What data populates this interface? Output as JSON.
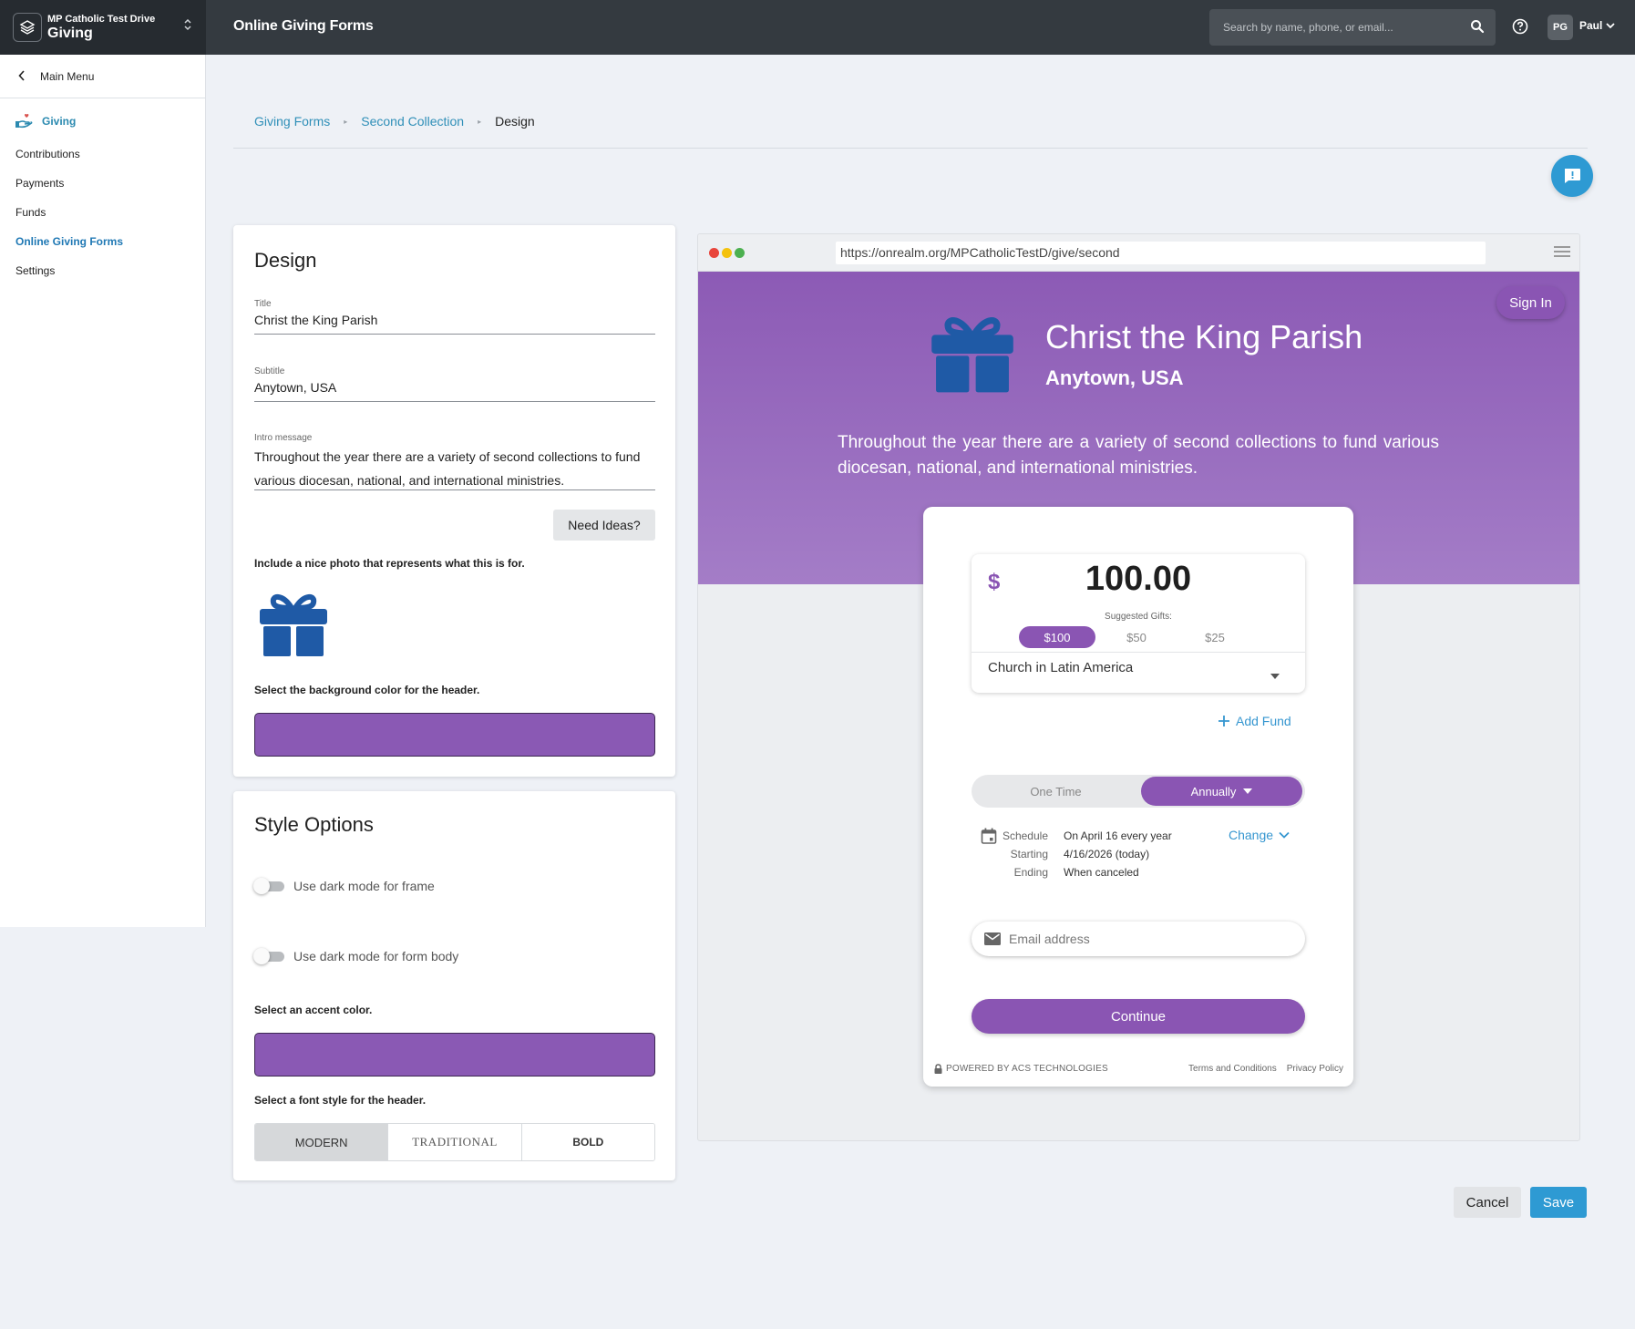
{
  "app": {
    "org": "MP Catholic Test Drive",
    "name": "Giving",
    "page_heading": "Online Giving Forms",
    "search_placeholder": "Search by name, phone, or email...",
    "user_initials": "PG",
    "user_name": "Paul"
  },
  "sidebar": {
    "main_menu": "Main Menu",
    "section": "Giving",
    "items": [
      {
        "label": "Contributions",
        "active": false
      },
      {
        "label": "Payments",
        "active": false
      },
      {
        "label": "Funds",
        "active": false
      },
      {
        "label": "Online Giving Forms",
        "active": true
      },
      {
        "label": "Settings",
        "active": false
      }
    ]
  },
  "breadcrumb": [
    "Giving Forms",
    "Second Collection",
    "Design"
  ],
  "design": {
    "heading": "Design",
    "title_label": "Title",
    "title_value": "Christ the King Parish",
    "subtitle_label": "Subtitle",
    "subtitle_value": "Anytown, USA",
    "intro_label": "Intro message",
    "intro_value": "Throughout the year there are a variety of second collections to fund various diocesan, national, and international ministries.",
    "need_ideas": "Need Ideas?",
    "photo_instruction": "Include a nice photo that represents what this is for.",
    "photo_icon": "gift-icon",
    "bg_instruction": "Select the background color for the header.",
    "bg_color": "#8a59b4"
  },
  "style_options": {
    "heading": "Style Options",
    "dark_frame": "Use dark mode for frame",
    "dark_body": "Use dark mode for form body",
    "accent_instruction": "Select an accent color.",
    "accent_color": "#8a59b4",
    "font_instruction": "Select a font style for the header.",
    "fonts": [
      "MODERN",
      "TRADITIONAL",
      "BOLD"
    ],
    "selected_font": "MODERN"
  },
  "preview": {
    "url": "https://onrealm.org/MPCatholicTestD/give/second",
    "sign_in": "Sign In",
    "title": "Christ the King Parish",
    "subtitle": "Anytown, USA",
    "intro": "Throughout the year there are a variety of second collections to fund various diocesan, national, and international ministries.",
    "currency": "$",
    "amount": "100.00",
    "suggested_label": "Suggested Gifts:",
    "gifts": [
      "$100",
      "$50",
      "$25"
    ],
    "selected_gift": "$100",
    "fund": "Church in Latin America",
    "add_fund": "Add Fund",
    "freq_once": "One Time",
    "freq_annual": "Annually",
    "schedule": [
      {
        "key": "Schedule",
        "value": "On April 16 every year"
      },
      {
        "key": "Starting",
        "value": "4/16/2026 (today)"
      },
      {
        "key": "Ending",
        "value": "When canceled"
      }
    ],
    "change": "Change",
    "email_placeholder": "Email address",
    "continue": "Continue",
    "powered_by": "POWERED BY ACS TECHNOLOGIES",
    "terms": "Terms and Conditions",
    "privacy": "Privacy Policy",
    "accent": "#8a55b3"
  },
  "actions": {
    "cancel": "Cancel",
    "save": "Save"
  }
}
